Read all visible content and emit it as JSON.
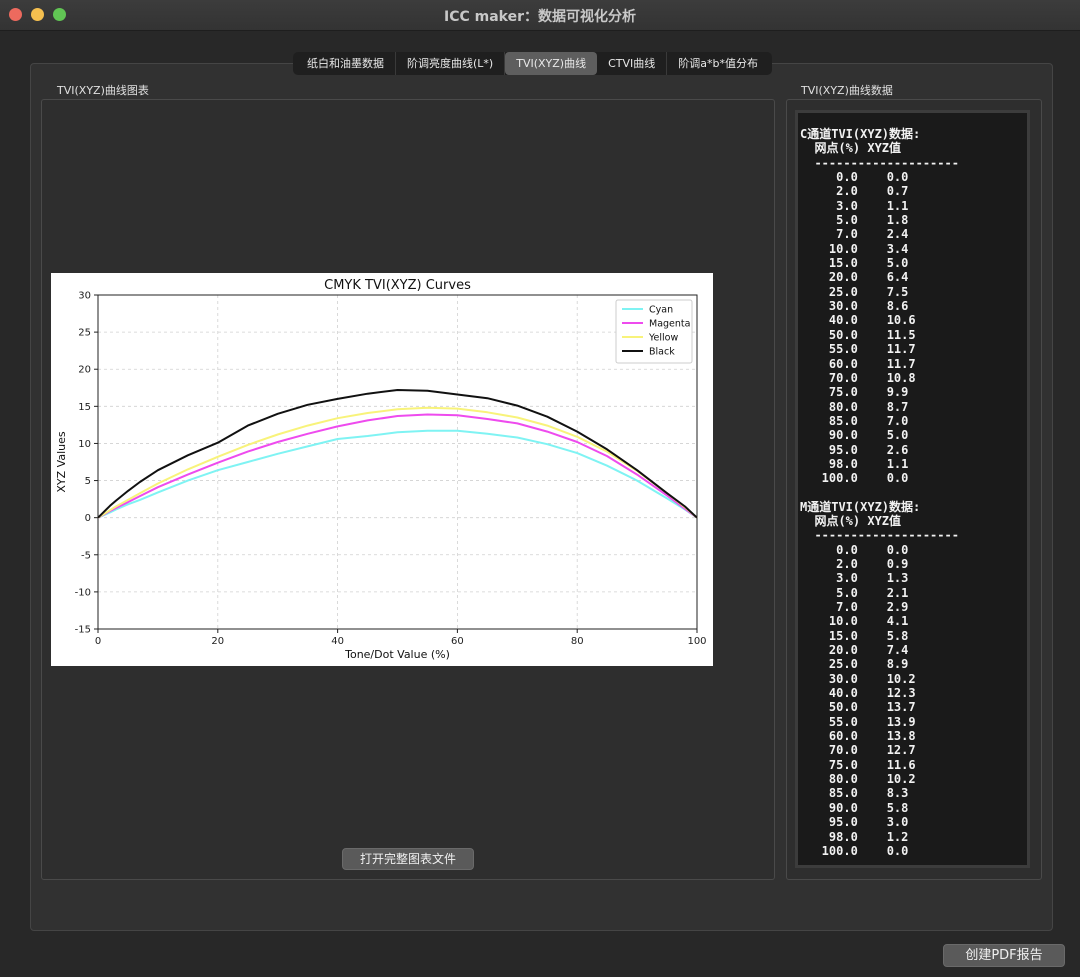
{
  "window": {
    "title": "ICC maker：数据可视化分析"
  },
  "tabs": [
    {
      "label": "纸白和油墨数据"
    },
    {
      "label": "阶调亮度曲线(L*)"
    },
    {
      "label": "TVI(XYZ)曲线"
    },
    {
      "label": "CTVI曲线"
    },
    {
      "label": "阶调a*b*值分布"
    }
  ],
  "active_tab": 2,
  "chart_group": {
    "label": "TVI(XYZ)曲线图表",
    "open_button": "打开完整图表文件"
  },
  "data_group": {
    "label": "TVI(XYZ)曲线数据"
  },
  "footer": {
    "pdf_button": "创建PDF报告"
  },
  "data_text": {
    "c_header": "C通道TVI(XYZ)数据:",
    "m_header": "M通道TVI(XYZ)数据:",
    "col_header": "  网点(%) XYZ值",
    "separator": "  --------------------"
  },
  "table_c": {
    "dot": [
      0.0,
      2.0,
      3.0,
      5.0,
      7.0,
      10.0,
      15.0,
      20.0,
      25.0,
      30.0,
      40.0,
      50.0,
      55.0,
      60.0,
      70.0,
      75.0,
      80.0,
      85.0,
      90.0,
      95.0,
      98.0,
      100.0
    ],
    "xyz": [
      0.0,
      0.7,
      1.1,
      1.8,
      2.4,
      3.4,
      5.0,
      6.4,
      7.5,
      8.6,
      10.6,
      11.5,
      11.7,
      11.7,
      10.8,
      9.9,
      8.7,
      7.0,
      5.0,
      2.6,
      1.1,
      0.0
    ]
  },
  "table_m": {
    "dot": [
      0.0,
      2.0,
      3.0,
      5.0,
      7.0,
      10.0,
      15.0,
      20.0,
      25.0,
      30.0,
      40.0,
      50.0,
      55.0,
      60.0,
      70.0,
      75.0,
      80.0,
      85.0,
      90.0,
      95.0,
      98.0,
      100.0
    ],
    "xyz": [
      0.0,
      0.9,
      1.3,
      2.1,
      2.9,
      4.1,
      5.8,
      7.4,
      8.9,
      10.2,
      12.3,
      13.7,
      13.9,
      13.8,
      12.7,
      11.6,
      10.2,
      8.3,
      5.8,
      3.0,
      1.2,
      0.0
    ]
  },
  "chart_data": {
    "type": "line",
    "title": "CMYK TVI(XYZ) Curves",
    "xlabel": "Tone/Dot Value (%)",
    "ylabel": "XYZ Values",
    "xlim": [
      0,
      100
    ],
    "ylim": [
      -15,
      30
    ],
    "xticks": [
      0,
      20,
      40,
      60,
      80,
      100
    ],
    "yticks": [
      -15,
      -10,
      -5,
      0,
      5,
      10,
      15,
      20,
      25,
      30
    ],
    "grid": true,
    "legend": "top-right",
    "x": [
      0,
      2,
      3,
      5,
      7,
      10,
      15,
      20,
      25,
      30,
      35,
      40,
      45,
      50,
      55,
      60,
      65,
      70,
      75,
      80,
      85,
      90,
      95,
      98,
      100
    ],
    "series": [
      {
        "name": "Cyan",
        "color": "#7ff3f3",
        "values": [
          0,
          0.7,
          1.1,
          1.8,
          2.4,
          3.4,
          5.0,
          6.4,
          7.5,
          8.6,
          9.6,
          10.6,
          11.0,
          11.5,
          11.7,
          11.7,
          11.3,
          10.8,
          9.9,
          8.7,
          7.0,
          5.0,
          2.6,
          1.1,
          0
        ]
      },
      {
        "name": "Magenta",
        "color": "#ee4bee",
        "values": [
          0,
          0.9,
          1.3,
          2.1,
          2.9,
          4.1,
          5.8,
          7.4,
          8.9,
          10.2,
          11.3,
          12.3,
          13.1,
          13.7,
          13.9,
          13.8,
          13.3,
          12.7,
          11.6,
          10.2,
          8.3,
          5.8,
          3.0,
          1.2,
          0
        ]
      },
      {
        "name": "Yellow",
        "color": "#f8f37a",
        "values": [
          0,
          1.0,
          1.5,
          2.4,
          3.3,
          4.6,
          6.5,
          8.2,
          9.8,
          11.2,
          12.4,
          13.4,
          14.1,
          14.6,
          14.8,
          14.7,
          14.2,
          13.5,
          12.4,
          10.9,
          8.9,
          6.3,
          3.3,
          1.4,
          0
        ]
      },
      {
        "name": "Black",
        "color": "#111111",
        "values": [
          0,
          1.6,
          2.3,
          3.6,
          4.8,
          6.4,
          8.4,
          10.1,
          12.4,
          14.0,
          15.2,
          16.0,
          16.7,
          17.2,
          17.1,
          16.6,
          16.1,
          15.1,
          13.6,
          11.6,
          9.2,
          6.4,
          3.3,
          1.5,
          0
        ]
      }
    ]
  }
}
